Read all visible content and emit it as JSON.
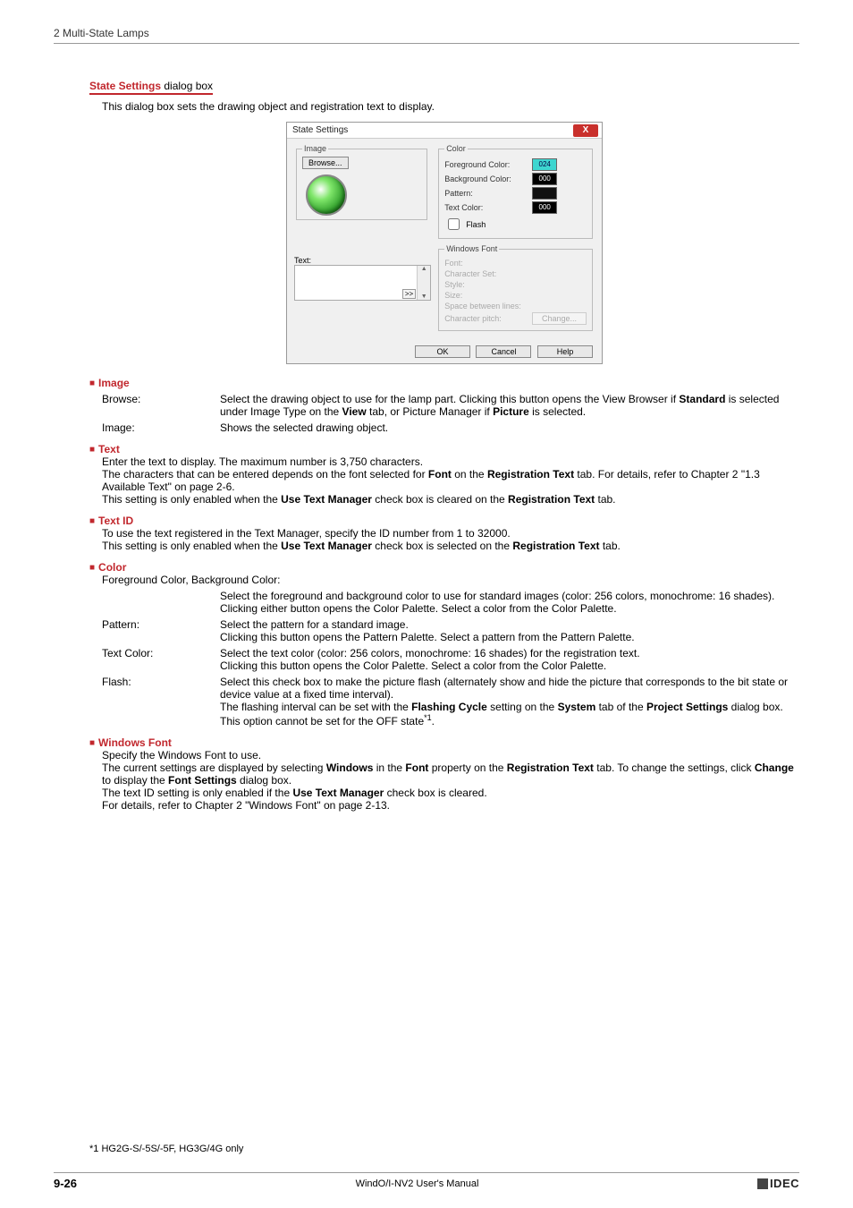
{
  "header": {
    "section": "2 Multi-State Lamps"
  },
  "title": {
    "bold": "State Settings",
    "rest": " dialog box"
  },
  "intro": "This dialog box sets the drawing object and registration text to display.",
  "dialog": {
    "title": "State Settings",
    "close": "X",
    "image_legend": "Image",
    "browse": "Browse...",
    "text_label": "Text:",
    "expand": ">>",
    "color_legend": "Color",
    "fg_label": "Foreground Color:",
    "fg_swatch_text": "024",
    "bg_label": "Background Color:",
    "bg_swatch_text": "000",
    "pattern_label": "Pattern:",
    "textcolor_label": "Text Color:",
    "textcolor_swatch": "000",
    "flash_label": "Flash",
    "wf_legend": "Windows Font",
    "font_label": "Font:",
    "charset_label": "Character Set:",
    "style_label": "Style:",
    "size_label": "Size:",
    "sbl_label": "Space between lines:",
    "cp_label": "Character pitch:",
    "change": "Change...",
    "ok": "OK",
    "cancel": "Cancel",
    "help": "Help"
  },
  "sec_image": {
    "head": "Image",
    "browse_k": "Browse:",
    "browse_v1": "Select the drawing object to use for the lamp part. Clicking this button opens the View Browser if ",
    "browse_b1": "Standard",
    "browse_v2": " is selected under Image Type on the ",
    "browse_b2": "View",
    "browse_v3": " tab, or Picture Manager if ",
    "browse_b3": "Picture",
    "browse_v4": " is selected.",
    "image_k": "Image:",
    "image_v": "Shows the selected drawing object."
  },
  "sec_text": {
    "head": "Text",
    "p1": "Enter the text to display. The maximum number is 3,750 characters.",
    "p2a": "The characters that can be entered depends on the font selected for ",
    "p2b1": "Font",
    "p2c": " on the ",
    "p2b2": "Registration Text",
    "p2d": " tab. For details, refer to Chapter 2 \"1.3 Available Text\" on page 2-6.",
    "p3a": "This setting is only enabled when the ",
    "p3b": "Use Text Manager",
    "p3c": " check box is cleared on the ",
    "p3d": "Registration Text",
    "p3e": " tab."
  },
  "sec_textid": {
    "head": "Text ID",
    "p1": "To use the text registered in the Text Manager, specify the ID number from 1 to 32000.",
    "p2a": "This setting is only enabled when the ",
    "p2b": "Use Text Manager",
    "p2c": " check box is selected on the ",
    "p2d": "Registration Text",
    "p2e": " tab."
  },
  "sec_color": {
    "head": "Color",
    "p1": "Foreground Color, Background Color:",
    "fgbg_v1": "Select the foreground and background color to use for standard images (color: 256 colors, monochrome: 16 shades).",
    "fgbg_v2": "Clicking either button opens the Color Palette. Select a color from the Color Palette.",
    "pattern_k": "Pattern:",
    "pattern_v1": "Select the pattern for a standard image.",
    "pattern_v2": "Clicking this button opens the Pattern Palette. Select a pattern from the Pattern Palette.",
    "tc_k": "Text Color:",
    "tc_v1": "Select the text color (color: 256 colors, monochrome: 16 shades) for the registration text.",
    "tc_v2": "Clicking this button opens the Color Palette. Select a color from the Color Palette.",
    "flash_k": "Flash:",
    "flash_v1": "Select this check box to make the picture flash (alternately show and hide the picture that corresponds to the bit state or device value at a fixed time interval).",
    "flash_v2a": "The flashing interval can be set with the ",
    "flash_v2b": "Flashing Cycle",
    "flash_v2c": " setting on the ",
    "flash_v2d": "System",
    "flash_v2e": " tab of the ",
    "flash_v2f": "Project Settings",
    "flash_v2g": " dialog box. This option cannot be set for the OFF state",
    "flash_sup": "*1",
    "flash_v2h": "."
  },
  "sec_wf": {
    "head": "Windows Font",
    "p1": "Specify the Windows Font to use.",
    "p2a": "The current settings are displayed by selecting ",
    "p2b1": "Windows",
    "p2c": " in the ",
    "p2b2": "Font",
    "p2d": " property on the ",
    "p2b3": "Registration Text",
    "p2e": " tab. To change the settings, click ",
    "p2b4": "Change",
    "p2f": " to display the ",
    "p2b5": "Font Settings",
    "p2g": " dialog box.",
    "p3a": "The text ID setting is only enabled if the ",
    "p3b": "Use Text Manager",
    "p3c": " check box is cleared.",
    "p4": "For details, refer to Chapter 2 \"Windows Font\" on page 2-13."
  },
  "footnote": "*1  HG2G-S/-5S/-5F, HG3G/4G only",
  "footer": {
    "pagenum": "9-26",
    "center": "WindO/I-NV2 User's Manual",
    "logo": "IDEC"
  }
}
